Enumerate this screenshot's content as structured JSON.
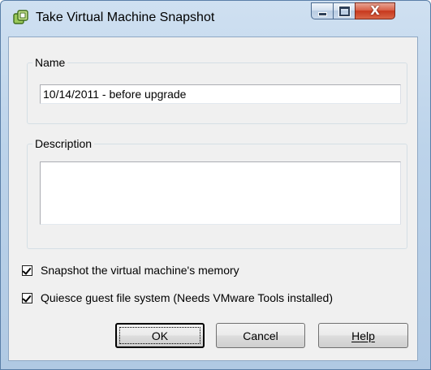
{
  "window": {
    "title": "Take Virtual Machine Snapshot",
    "icons": {
      "app": "snapshot-app-icon",
      "minimize": "minimize-icon",
      "maximize": "maximize-icon",
      "close": "close-icon"
    },
    "close_glyph": "X",
    "colors": {
      "frame": "#bcd3ea",
      "client": "#f0f0f0",
      "close_button": "#c7381e"
    }
  },
  "name_group": {
    "label": "Name",
    "value": "10/14/2011 - before upgrade"
  },
  "description_group": {
    "label": "Description",
    "value": ""
  },
  "options": {
    "snapshot_memory": {
      "label": "Snapshot the virtual machine's memory",
      "checked": true
    },
    "quiesce": {
      "label": "Quiesce guest file system (Needs VMware Tools installed)",
      "checked": true
    }
  },
  "buttons": {
    "ok": "OK",
    "cancel": "Cancel",
    "help": "Help"
  }
}
